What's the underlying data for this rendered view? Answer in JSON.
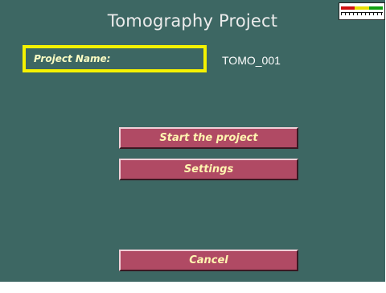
{
  "header": {
    "title": "Tomography Project"
  },
  "ruler": {
    "colors": [
      "#d01010",
      "#e8e000",
      "#10a010"
    ]
  },
  "project": {
    "label": "Project Name:",
    "value": "TOMO_001"
  },
  "buttons": {
    "start_label": "Start the project",
    "settings_label": "Settings",
    "cancel_label": "Cancel"
  },
  "colors": {
    "background": "#3d6763",
    "button": "#b04a64",
    "button_text": "#fff5b0",
    "highlight_border": "#f5f200"
  }
}
